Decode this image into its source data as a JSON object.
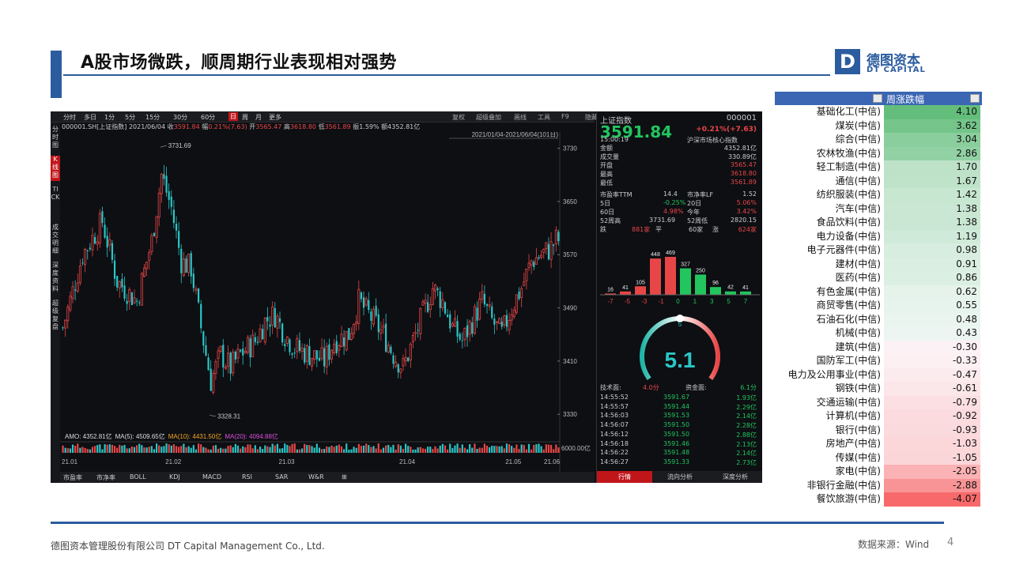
{
  "slide": {
    "title": "A股市场微跌，顺周期行业表现相对强势",
    "logo_glyph": "D",
    "logo_cn": "德图资本",
    "logo_en": "DT CAPITAL",
    "footer_company": "德图资本管理股份有限公司  DT Capital  Management  Co., Ltd.",
    "footer_source": "数据来源：Wind",
    "page_number": "4"
  },
  "terminal": {
    "toolbar": [
      "分时",
      "多日",
      "1分",
      "5分",
      "15分",
      "30分",
      "60分",
      "日",
      "周",
      "月",
      "更多"
    ],
    "toolbar_selected": "日",
    "toolbar_right": [
      "复权",
      "超级叠加",
      "画线",
      "工具",
      "F9",
      "隐藏"
    ],
    "left_sidebar": [
      "分时图",
      "K线图",
      "TICK",
      "成交明细",
      "深度资料",
      "超级复盘"
    ],
    "left_sidebar_selected": "K线图",
    "info_line": {
      "code": "000001.SH[上证指数]",
      "date": "2021/06/04",
      "close_label": "收",
      "close": "3591.84",
      "change_label": "幅",
      "change": "0.21%(7.63)",
      "open_label": "开",
      "open": "3565.47",
      "high_label": "高",
      "high": "3618.80",
      "low_label": "低",
      "low": "3561.89",
      "amp_label": "振",
      "amp": "1.59%",
      "amount_label": "额",
      "amount": "4352.81亿"
    },
    "range_label": "2021/01/04-2021/06/04(101日)",
    "high_marker": "3731.69",
    "low_marker": "3328.31",
    "amo_line": {
      "amo": "AMO: 4352.81亿",
      "ma5": "MA(5): 4509.65亿",
      "ma10": "MA(10): 4431.50亿",
      "ma20": "MA(20): 4094.88亿"
    },
    "volume_axis": "6000.00亿",
    "bottom_tabs": [
      "市盈率",
      "市净率",
      "BOLL",
      "KDJ",
      "MACD",
      "RSI",
      "SAR",
      "W&R",
      "⊞"
    ],
    "right_panel": {
      "name": "上证指数",
      "code": "000001",
      "price": "3591.84",
      "change": "+0.21%(+7.63)",
      "time": "15:00:19",
      "core_label": "沪深市场核心指数",
      "stats": [
        {
          "label": "金额",
          "value": "4352.81亿"
        },
        {
          "label": "成交量",
          "value": "330.89亿"
        },
        {
          "label": "开盘",
          "value": "3565.47"
        },
        {
          "label": "最高",
          "value": "3618.80"
        },
        {
          "label": "最低",
          "value": "3561.89"
        }
      ],
      "pe_label": "市盈率TTM",
      "pe": "14.4",
      "pb_label": "市净率LF",
      "pb": "1.52",
      "d5_label": "5日",
      "d5": "-0.25%",
      "d20_label": "20日",
      "d20": "5.06%",
      "d60_label": "60日",
      "d60": "4.98%",
      "ytd_label": "今年",
      "ytd": "3.42%",
      "h52_label": "52周高",
      "h52": "3731.69",
      "l52_label": "52周低",
      "l52": "2820.15",
      "down_label": "跌",
      "down": "881家",
      "flat_label": "平",
      "flat_count": "60家",
      "up_label": "涨",
      "up": "624家",
      "dist_values": [
        "16",
        "41",
        "105",
        "448",
        "469",
        "327",
        "250",
        "96",
        "42",
        "41"
      ],
      "dist_axis": [
        "-7",
        "-5",
        "-3",
        "-1",
        "0",
        "1",
        "3",
        "5",
        "7"
      ],
      "gauge_value": "5.1",
      "gauge_level": 5,
      "gauge_min": "0",
      "gauge_max": "10",
      "gauge_top": "5",
      "tech_label": "技术面:",
      "tech": "4.0分",
      "fund_label": "资金面:",
      "fund": "6.1分",
      "ticks": [
        {
          "t": "14:55:52",
          "p": "3591.67",
          "v": "1.93亿"
        },
        {
          "t": "14:55:57",
          "p": "3591.44",
          "v": "2.29亿"
        },
        {
          "t": "14:56:03",
          "p": "3591.53",
          "v": "2.14亿"
        },
        {
          "t": "14:56:07",
          "p": "3591.50",
          "v": "2.28亿"
        },
        {
          "t": "14:56:12",
          "p": "3591.50",
          "v": "2.88亿"
        },
        {
          "t": "14:56:18",
          "p": "3591.46",
          "v": "2.13亿"
        },
        {
          "t": "14:56:22",
          "p": "3591.48",
          "v": "2.14亿"
        },
        {
          "t": "14:56:27",
          "p": "3591.33",
          "v": "2.73亿"
        }
      ],
      "tabs": [
        "行情",
        "流向分析",
        "深度分析"
      ]
    },
    "chart_data": {
      "type": "candlestick",
      "y_ticks": [
        "3730",
        "3650",
        "3570",
        "3490",
        "3410",
        "3330"
      ],
      "ylim": [
        3310,
        3745
      ],
      "x_ticks": [
        "21.01",
        "21.02",
        "21.03",
        "21.04",
        "21.05",
        "21.06"
      ]
    }
  },
  "sector_table": {
    "header": "周涨跌幅",
    "colors": {
      "positive": "#63be7b",
      "negative": "#f8696b",
      "neutral": "#fcfcff"
    },
    "rows": [
      {
        "name": "基础化工(中信)",
        "value": "4.10",
        "num": 4.1
      },
      {
        "name": "煤炭(中信)",
        "value": "3.62",
        "num": 3.62
      },
      {
        "name": "综合(中信)",
        "value": "3.04",
        "num": 3.04
      },
      {
        "name": "农林牧渔(中信)",
        "value": "2.86",
        "num": 2.86
      },
      {
        "name": "轻工制造(中信)",
        "value": "1.70",
        "num": 1.7
      },
      {
        "name": "通信(中信)",
        "value": "1.67",
        "num": 1.67
      },
      {
        "name": "纺织服装(中信)",
        "value": "1.42",
        "num": 1.42
      },
      {
        "name": "汽车(中信)",
        "value": "1.38",
        "num": 1.38
      },
      {
        "name": "食品饮料(中信)",
        "value": "1.38",
        "num": 1.38
      },
      {
        "name": "电力设备(中信)",
        "value": "1.19",
        "num": 1.19
      },
      {
        "name": "电子元器件(中信)",
        "value": "0.98",
        "num": 0.98
      },
      {
        "name": "建材(中信)",
        "value": "0.91",
        "num": 0.91
      },
      {
        "name": "医药(中信)",
        "value": "0.86",
        "num": 0.86
      },
      {
        "name": "有色金属(中信)",
        "value": "0.62",
        "num": 0.62
      },
      {
        "name": "商贸零售(中信)",
        "value": "0.55",
        "num": 0.55
      },
      {
        "name": "石油石化(中信)",
        "value": "0.48",
        "num": 0.48
      },
      {
        "name": "机械(中信)",
        "value": "0.43",
        "num": 0.43
      },
      {
        "name": "建筑(中信)",
        "value": "-0.30",
        "num": -0.3
      },
      {
        "name": "国防军工(中信)",
        "value": "-0.33",
        "num": -0.33
      },
      {
        "name": "电力及公用事业(中信)",
        "value": "-0.47",
        "num": -0.47
      },
      {
        "name": "钢铁(中信)",
        "value": "-0.61",
        "num": -0.61
      },
      {
        "name": "交通运输(中信)",
        "value": "-0.79",
        "num": -0.79
      },
      {
        "name": "计算机(中信)",
        "value": "-0.92",
        "num": -0.92
      },
      {
        "name": "银行(中信)",
        "value": "-0.93",
        "num": -0.93
      },
      {
        "name": "房地产(中信)",
        "value": "-1.03",
        "num": -1.03
      },
      {
        "name": "传媒(中信)",
        "value": "-1.05",
        "num": -1.05
      },
      {
        "name": "家电(中信)",
        "value": "-2.05",
        "num": -2.05
      },
      {
        "name": "非银行金融(中信)",
        "value": "-2.88",
        "num": -2.88
      },
      {
        "name": "餐饮旅游(中信)",
        "value": "-4.07",
        "num": -4.07
      }
    ]
  }
}
